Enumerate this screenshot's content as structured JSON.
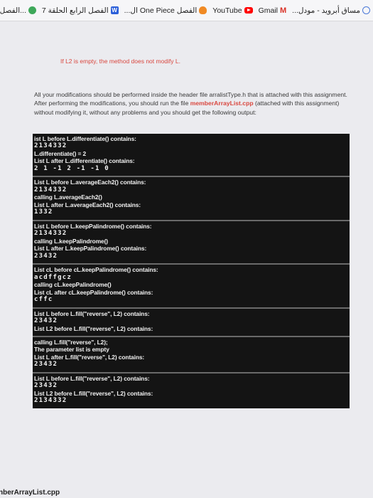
{
  "bookmarks": [
    {
      "icon": "moodle-icon",
      "label": "...مساق أبرويد - مودل"
    },
    {
      "icon": "gmail-icon",
      "label": "Gmail"
    },
    {
      "icon": "youtube-icon",
      "label": "YouTube"
    },
    {
      "icon": "fire-icon",
      "label": "...ال One Piece الفصل"
    },
    {
      "icon": "word-icon",
      "label": "الفصل الرابع الحلقة 7"
    },
    {
      "icon": "green-icon",
      "label": "الفصل ال..."
    }
  ],
  "note": "If L2 is empty, the method does not modify L.",
  "paragraph": {
    "before_highlight": "All your modifications should be performed inside the header file arralistType.h that is attached with this assignment. After performing the modifications, you should run the file ",
    "highlight": "memberArrayList.cpp",
    "after_highlight": " (attached with this assignment) without modifying it, without any problems and you should get the following output:"
  },
  "console_blocks": [
    [
      "ist L before L.differentiate() contains:",
      "#2134332",
      "L.differentiate() = 2",
      "List L after L.differentiate() contains:",
      "#2 1 -1 2 -1 -1 0"
    ],
    [
      "List L before L.averageEach2() contains:",
      "#2134332",
      "calling L.averageEach2()",
      "List L after L.averageEach2() contains:",
      "#1332"
    ],
    [
      "List L before L.keepPalindrome() contains:",
      "#2134332",
      "calling L.keepPalindrome()",
      "List L after L.keepPalindrome() contains:",
      "#23432"
    ],
    [
      "List cL before cL.keepPalindrome() contains:",
      "#acdffgcz",
      "calling cL.keepPalindrome()",
      "List cL after cL.keepPalindrome() contains:",
      "#cffc"
    ],
    [
      "List L before L.fill(\"reverse\", L2) contains:",
      "#23432",
      "List L2 before L.fill(\"reverse\", L2) contains:"
    ],
    [
      "calling L.fill(\"reverse\", L2);",
      "The parameter list is empty",
      "List L after L.fill(\"reverse\", L2) contains:",
      "#23432"
    ],
    [
      "List L before L.fill(\"reverse\", L2) contains:",
      "#23432",
      "List L2 before L.fill(\"reverse\", L2) contains:",
      "#2134332"
    ]
  ],
  "bottom_label": "nberArrayList.cpp"
}
